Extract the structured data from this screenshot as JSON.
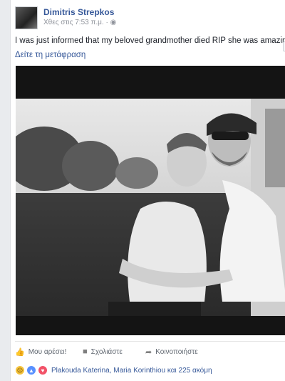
{
  "post": {
    "author": "Dimitris Strepkos",
    "timestamp": "Χθες στις 7:53 π.μ.",
    "privacy_icon": "globe-icon",
    "text": "I was just informed that my beloved grandmother died RIP she was amazing",
    "translate_link": "Δείτε τη μετάφραση"
  },
  "actions": {
    "like_label": "Μου αρέσει!",
    "comment_label": "Σχολιάστε",
    "share_label": "Κοινοποιήστε"
  },
  "reactions": {
    "icons": [
      "sad-reaction-icon",
      "like-reaction-icon",
      "love-reaction-icon"
    ],
    "summary": "Plakouda Katerina, Maria Korinthiou και 225 ακόμη"
  },
  "colors": {
    "link_blue": "#365899",
    "text": "#1d2129",
    "meta_gray": "#90949c",
    "page_bg": "#e9ebee"
  }
}
